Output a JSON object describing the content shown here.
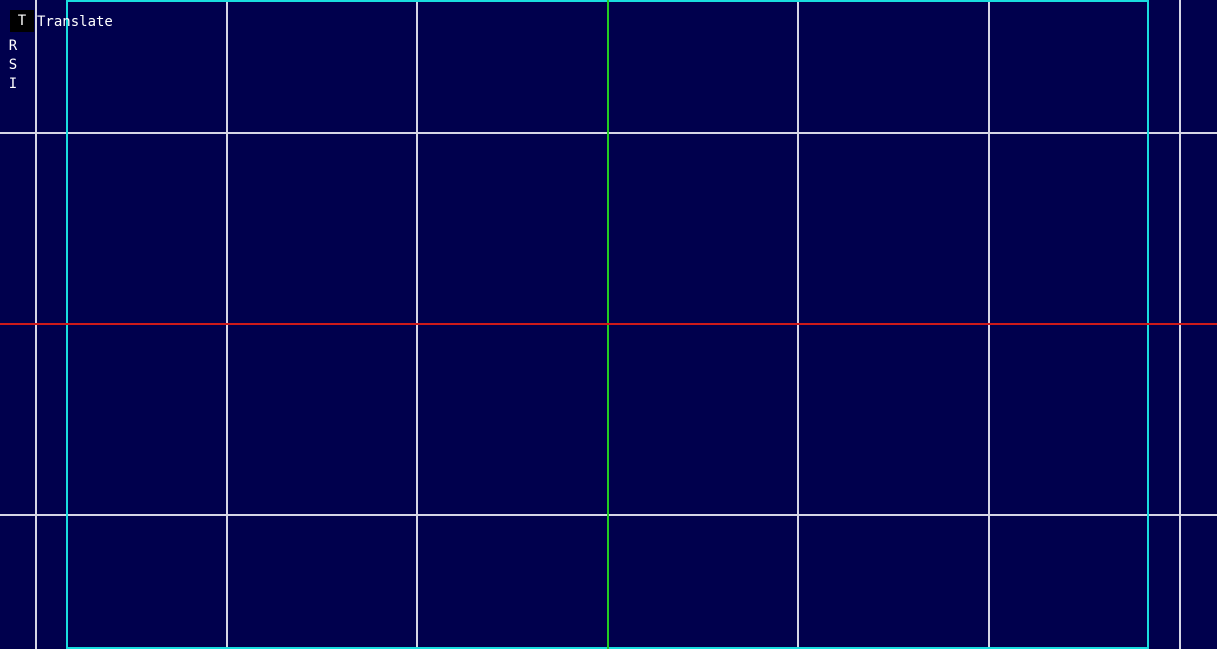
{
  "colors": {
    "background": "#00004d",
    "grid_line": "#d6d6e6",
    "x_axis": "#cc1a1a",
    "y_axis": "#22cc22",
    "frame": "#19dede",
    "tool_active_bg": "#000000",
    "text": "#ffffff"
  },
  "toolbar": {
    "active_key": "T",
    "active_label": "Translate",
    "other_keys": [
      "R",
      "S",
      "I"
    ]
  }
}
